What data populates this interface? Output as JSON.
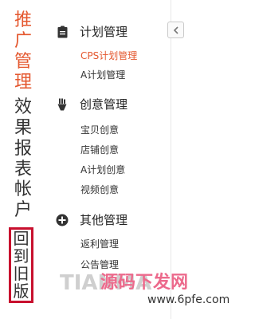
{
  "left_nav": {
    "promo": [
      "推",
      "广",
      "管",
      "理"
    ],
    "report": [
      "效",
      "果",
      "报",
      "表"
    ],
    "account": [
      "帐",
      "户"
    ],
    "old_version": [
      "回",
      "到",
      "旧",
      "版"
    ]
  },
  "groups": [
    {
      "title": "计划管理",
      "icon": "clipboard-icon",
      "items": [
        "CPS计划管理",
        "A计划管理"
      ]
    },
    {
      "title": "创意管理",
      "icon": "brush-icon",
      "items": [
        "宝贝创意",
        "店铺创意",
        "A计划创意",
        "视频创意"
      ]
    },
    {
      "title": "其他管理",
      "icon": "plus-circle-icon",
      "items": [
        "返利管理",
        "公告管理"
      ]
    }
  ],
  "collapse_button": {
    "icon": "chevron-left-icon"
  },
  "watermark": {
    "en": "TIANMA",
    "cn": "源码下发网",
    "url": "www.6pfe.com"
  },
  "colors": {
    "accent": "#e4572e",
    "highlight_border": "#c8102e"
  }
}
